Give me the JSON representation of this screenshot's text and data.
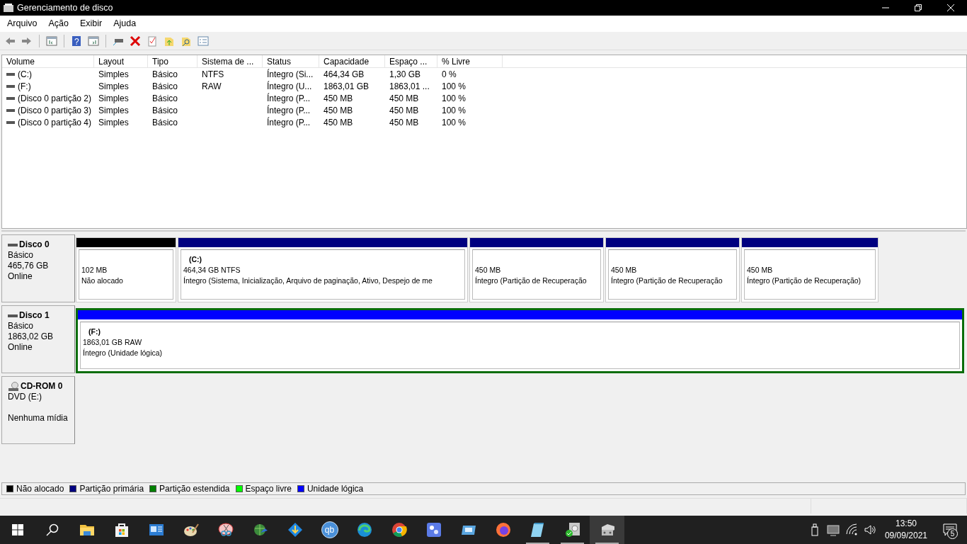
{
  "window": {
    "title": "Gerenciamento de disco"
  },
  "menu": [
    "Arquivo",
    "Ação",
    "Exibir",
    "Ajuda"
  ],
  "toolbar": {
    "help_mark": "?"
  },
  "table": {
    "columns": [
      "Volume",
      "Layout",
      "Tipo",
      "Sistema de ...",
      "Status",
      "Capacidade",
      "Espaço ...",
      "% Livre"
    ],
    "rows": [
      {
        "cells": [
          "(C:)",
          "Simples",
          "Básico",
          "NTFS",
          "Íntegro (Si...",
          "464,34 GB",
          "1,30 GB",
          "0 %"
        ]
      },
      {
        "cells": [
          "(F:)",
          "Simples",
          "Básico",
          "RAW",
          "Íntegro (U...",
          "1863,01 GB",
          "1863,01 ...",
          "100 %"
        ]
      },
      {
        "cells": [
          "(Disco 0 partição 2)",
          "Simples",
          "Básico",
          "",
          "Íntegro (P...",
          "450 MB",
          "450 MB",
          "100 %"
        ]
      },
      {
        "cells": [
          "(Disco 0 partição 3)",
          "Simples",
          "Básico",
          "",
          "Íntegro (P...",
          "450 MB",
          "450 MB",
          "100 %"
        ]
      },
      {
        "cells": [
          "(Disco 0 partição 4)",
          "Simples",
          "Básico",
          "",
          "Íntegro (P...",
          "450 MB",
          "450 MB",
          "100 %"
        ]
      }
    ]
  },
  "disks": [
    {
      "kind": "disk",
      "name": "Disco 0",
      "type": "Básico",
      "size": "465,76 GB",
      "status": "Online",
      "partitions": [
        {
          "size": "102 MB",
          "status": "Não alocado",
          "color": "#000000",
          "selected": false
        },
        {
          "label": "(C:)",
          "size": "464,34 GB NTFS",
          "status": "Íntegro (Sistema, Inicialização, Arquivo de paginação, Ativo, Despejo de me",
          "color": "#000080",
          "selected": false
        },
        {
          "size": "450 MB",
          "status": "Íntegro (Partição de Recuperação",
          "color": "#000080",
          "selected": false
        },
        {
          "size": "450 MB",
          "status": "Íntegro (Partição de Recuperação",
          "color": "#000080",
          "selected": false
        },
        {
          "size": "450 MB",
          "status": "Íntegro (Partição de Recuperação)",
          "color": "#000080",
          "selected": false
        }
      ]
    },
    {
      "kind": "disk",
      "name": "Disco 1",
      "type": "Básico",
      "size": "1863,02 GB",
      "status": "Online",
      "partitions": [
        {
          "label": "(F:)",
          "size": "1863,01 GB RAW",
          "status": "Íntegro (Unidade lógica)",
          "color": "#0000ff",
          "selected": true
        }
      ]
    },
    {
      "kind": "cdrom",
      "name": "CD-ROM 0",
      "type": "DVD (E:)",
      "status": "Nenhuma mídia"
    }
  ],
  "legend": [
    {
      "label": "Não alocado",
      "color": "#000000"
    },
    {
      "label": "Partição primária",
      "color": "#000080"
    },
    {
      "label": "Partição estendida",
      "color": "#008000"
    },
    {
      "label": "Espaço livre",
      "color": "#00ff00"
    },
    {
      "label": "Unidade lógica",
      "color": "#0000ff"
    }
  ],
  "taskbar": {
    "apps": [
      {
        "kind": "folder",
        "running": false,
        "selected": false
      },
      {
        "kind": "store",
        "running": false,
        "selected": false
      },
      {
        "kind": "presentation",
        "running": false,
        "selected": false
      },
      {
        "kind": "palette",
        "running": false,
        "selected": false
      },
      {
        "kind": "scissors",
        "running": false,
        "selected": false
      },
      {
        "kind": "globe",
        "running": false,
        "selected": false
      },
      {
        "kind": "download",
        "running": false,
        "selected": false
      },
      {
        "kind": "text",
        "label": "qb",
        "running": false,
        "selected": false
      },
      {
        "kind": "edge",
        "running": false,
        "selected": false
      },
      {
        "kind": "chrome",
        "running": false,
        "selected": false
      },
      {
        "kind": "square",
        "running": false,
        "selected": false
      },
      {
        "kind": "window",
        "running": false,
        "selected": false
      },
      {
        "kind": "firefox",
        "running": false,
        "selected": false
      },
      {
        "kind": "notepad",
        "running": true,
        "selected": false
      },
      {
        "kind": "diskcheck",
        "running": true,
        "selected": false
      },
      {
        "kind": "drives",
        "running": true,
        "selected": true
      }
    ],
    "time": "13:50",
    "date": "09/09/2021",
    "notifications": "5"
  }
}
